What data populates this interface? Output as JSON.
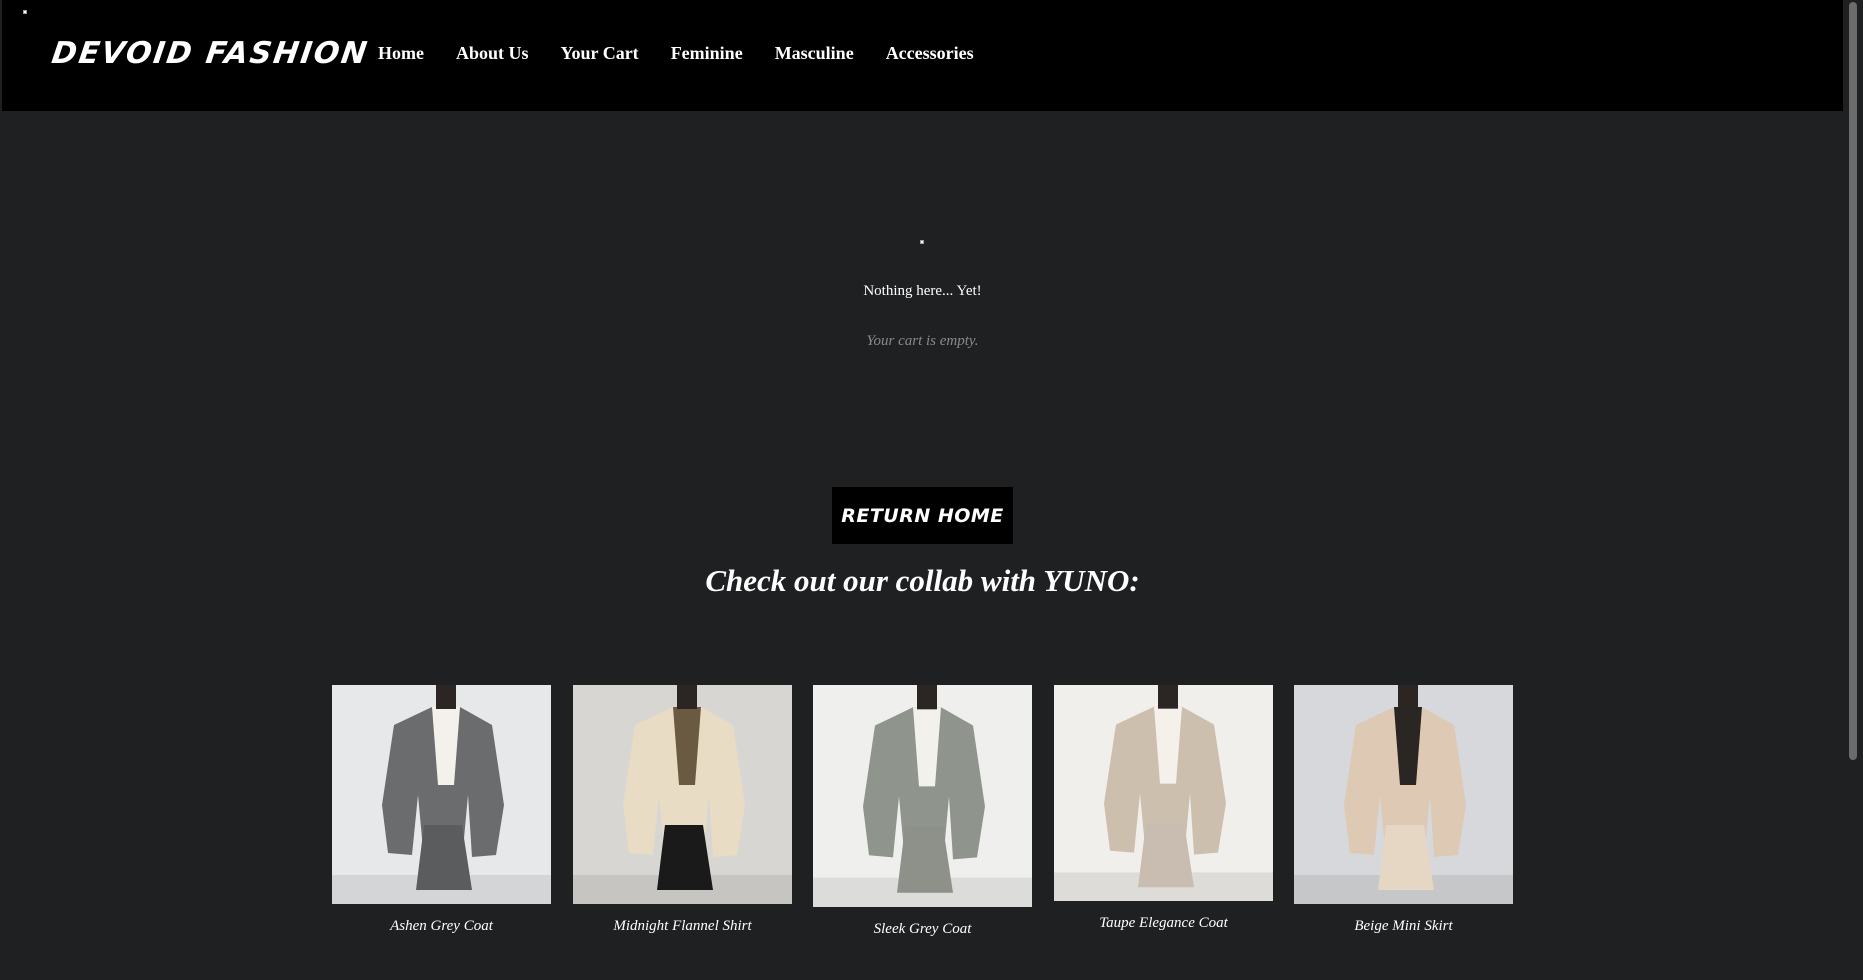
{
  "header": {
    "logo": "DEVOID FASHION",
    "nav": [
      "Home",
      "About Us",
      "Your Cart",
      "Feminine",
      "Masculine",
      "Accessories"
    ]
  },
  "cart": {
    "title": "Nothing here... Yet!",
    "subtitle": "Your cart is empty.",
    "return_button": "RETURN HOME"
  },
  "collab": {
    "heading": "Check out our collab with YUNO:",
    "products": [
      {
        "name": "Ashen Grey Coat",
        "bg": "#e6e8ea",
        "coat": "#6b6c6d",
        "inner": "#f4f1ec",
        "bottom": "#5b5c5e"
      },
      {
        "name": "Midnight Flannel Shirt",
        "bg": "#d8d6d2",
        "coat": "#e8dcc5",
        "inner": "#6b5a42",
        "bottom": "#1a1a1a"
      },
      {
        "name": "Sleek Grey Coat",
        "bg": "#efefed",
        "coat": "#8f948c",
        "inner": "#f2f1ec",
        "bottom": "#8d9189"
      },
      {
        "name": "Taupe Elegance Coat",
        "bg": "#f1efeb",
        "coat": "#cdbfae",
        "inner": "#f5f1ea",
        "bottom": "#c8bdb0"
      },
      {
        "name": "Beige Mini Skirt",
        "bg": "#d7d8db",
        "coat": "#ddc9b4",
        "inner": "#2a2624",
        "bottom": "#e6d6c4"
      }
    ]
  }
}
